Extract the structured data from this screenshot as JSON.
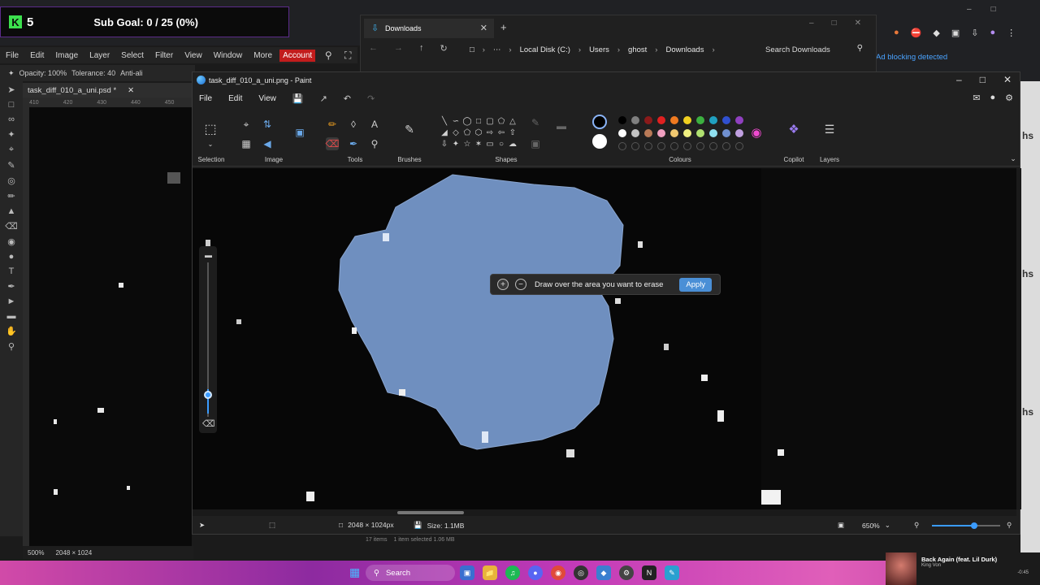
{
  "overlay": {
    "count": "5",
    "goal_text": "Sub Goal: 0 / 25 (0%)"
  },
  "photoshop": {
    "menu": [
      "File",
      "Edit",
      "Image",
      "Layer",
      "Select",
      "Filter",
      "View",
      "Window",
      "More"
    ],
    "account_label": "Account",
    "options": {
      "opacity": "Opacity: 100%",
      "tolerance": "Tolerance: 40",
      "antialias": "Anti-ali"
    },
    "tab_title": "task_diff_010_a_uni.psd *",
    "ruler_marks": [
      "410",
      "420",
      "430",
      "440",
      "450"
    ],
    "status_zoom": "500%",
    "status_size": "2048 × 1024",
    "right_letters": [
      "hs",
      "hs",
      "hs"
    ]
  },
  "explorer": {
    "tab_title": "Downloads",
    "breadcrumb": [
      "Local Disk (C:)",
      "Users",
      "ghost",
      "Downloads"
    ],
    "search_placeholder": "Search Downloads",
    "status": {
      "items": "17 items",
      "selected": "1 item selected  1.06 MB"
    }
  },
  "browser": {
    "ad_notice": "Ad blocking detected"
  },
  "paint": {
    "title": "task_diff_010_a_uni.png - Paint",
    "menu": {
      "file": "File",
      "edit": "Edit",
      "view": "View"
    },
    "groups": {
      "selection": "Selection",
      "image": "Image",
      "tools": "Tools",
      "brushes": "Brushes",
      "shapes": "Shapes",
      "colours": "Colours",
      "copilot": "Copilot",
      "layers": "Layers"
    },
    "palette": [
      "#000000",
      "#7f7f7f",
      "#8b1a1a",
      "#e02020",
      "#f07a20",
      "#f0d020",
      "#3cb040",
      "#20a0c0",
      "#3050d0",
      "#9040c0",
      "#ffffff",
      "#c3c3c3",
      "#b97a57",
      "#f0a0c0",
      "#f0c870",
      "#f0f080",
      "#b0e070",
      "#90e0f0",
      "#7090d0",
      "#c0a0e0"
    ],
    "erase_bar": {
      "text": "Draw over the area you want to erase",
      "apply_label": "Apply"
    },
    "status": {
      "dimensions": "2048 × 1024px",
      "size": "Size: 1.1MB",
      "zoom": "650%"
    },
    "zoom_level_fraction": 0.62
  },
  "taskbar": {
    "search_label": "Search"
  },
  "media": {
    "title": "Back Again (feat. Lil Durk)",
    "artist": "King Von",
    "time": "-0:45"
  }
}
